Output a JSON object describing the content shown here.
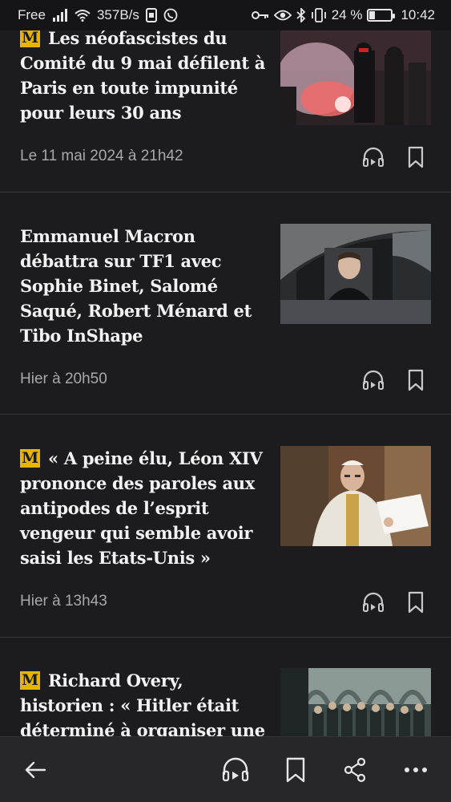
{
  "status_bar": {
    "carrier": "Free",
    "speed": "357B/s",
    "battery_percent": "24 %",
    "battery_level": 0.24,
    "time": "10:42",
    "icons": [
      "signal-icon",
      "wifi-icon",
      "sim-icon",
      "whatsapp-icon",
      "key-icon",
      "eye-icon",
      "bluetooth-icon",
      "vibrate-icon",
      "battery-icon"
    ]
  },
  "badge_glyph": "M",
  "articles": [
    {
      "title": "Les néofascistes du Comité du 9 mai défilent à Paris en toute impunité pour leurs 30 ans",
      "premium": true,
      "date": "Le 11 mai 2024 à 21h42",
      "image": "march-smoke-flares"
    },
    {
      "title": "Emmanuel Macron débattra sur TF1 avec Sophie Binet, Salomé Saqué, Robert Ménard et Tibo InShape",
      "premium": false,
      "date": "Hier à 20h50",
      "image": "man-in-car-window"
    },
    {
      "title": "« A peine élu, Léon XIV prononce des paroles aux antipodes de l’esprit vengeur qui semble avoir saisi les Etats-Unis »",
      "premium": true,
      "date": "Hier à 13h43",
      "image": "pope-reading"
    },
    {
      "title": "Richard Overy, historien : « Hitler était déterminé à organiser une",
      "premium": true,
      "date": "",
      "image": "historic-group-photo"
    }
  ],
  "bottom_nav": {
    "icons": [
      "back-arrow-icon",
      "headphones-icon",
      "bookmark-icon",
      "share-icon",
      "more-icon"
    ]
  },
  "colors": {
    "background": "#1c1c1e",
    "badge": "#e9b400",
    "divider": "#38383b",
    "meta_text": "#a8a8ac",
    "bottom_bar": "#27272a"
  }
}
